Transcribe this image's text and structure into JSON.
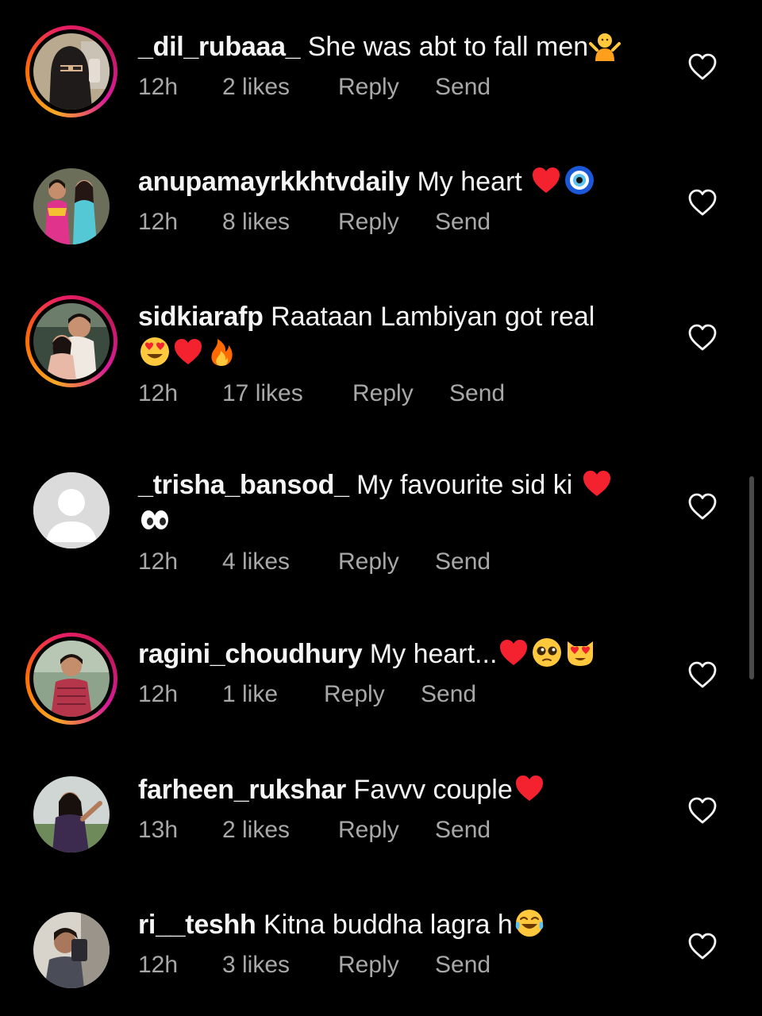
{
  "comments": [
    {
      "username": "_dil_rubaaa_",
      "text": "She was abt to fall men",
      "emojis": [
        "person-shrugging-emoji"
      ],
      "time": "12h",
      "likes": "2 likes",
      "reply": "Reply",
      "send": "Send",
      "has_story": true,
      "avatar": "veiled-person-photo"
    },
    {
      "username": "anupamayrkkhtvdaily",
      "text": "My heart ",
      "emojis": [
        "red-heart-emoji",
        "nazar-amulet-emoji"
      ],
      "time": "12h",
      "likes": "8 likes",
      "reply": "Reply",
      "send": "Send",
      "has_story": false,
      "avatar": "two-women-photo"
    },
    {
      "username": "sidkiarafp",
      "text": "Raataan Lambiyan got real",
      "emojis": [
        "heart-eyes-emoji",
        "red-heart-emoji",
        "fire-emoji"
      ],
      "time": "12h",
      "likes": "17 likes",
      "reply": "Reply",
      "send": "Send",
      "has_story": true,
      "avatar": "couple-hug-photo"
    },
    {
      "username": "_trisha_bansod_",
      "text": "My favourite sid ki ",
      "emojis": [
        "red-heart-emoji",
        "eyes-emoji"
      ],
      "time": "12h",
      "likes": "4 likes",
      "reply": "Reply",
      "send": "Send",
      "has_story": false,
      "avatar": "default-avatar"
    },
    {
      "username": "ragini_choudhury",
      "text": "My heart...",
      "emojis": [
        "red-heart-emoji",
        "pleading-face-emoji",
        "heart-eyes-cat-emoji"
      ],
      "time": "12h",
      "likes": "1 like",
      "reply": "Reply",
      "send": "Send",
      "has_story": true,
      "avatar": "girl-portrait-photo"
    },
    {
      "username": "farheen_rukshar",
      "text": "Favvv couple",
      "emojis": [
        "red-heart-emoji"
      ],
      "time": "13h",
      "likes": "2 likes",
      "reply": "Reply",
      "send": "Send",
      "has_story": false,
      "avatar": "woman-outdoor-photo"
    },
    {
      "username": "ri__teshh",
      "text": "Kitna buddha lagra h",
      "emojis": [
        "tears-of-joy-emoji"
      ],
      "time": "12h",
      "likes": "3 likes",
      "reply": "Reply",
      "send": "Send",
      "has_story": false,
      "avatar": "person-selfie-photo"
    }
  ],
  "colors": {
    "background": "#000000",
    "primary_text": "#f5f5f5",
    "secondary_text": "#a8a8a8",
    "story_ring": [
      "#f9a825",
      "#ff6d00",
      "#e91e63",
      "#d81b9a"
    ]
  }
}
